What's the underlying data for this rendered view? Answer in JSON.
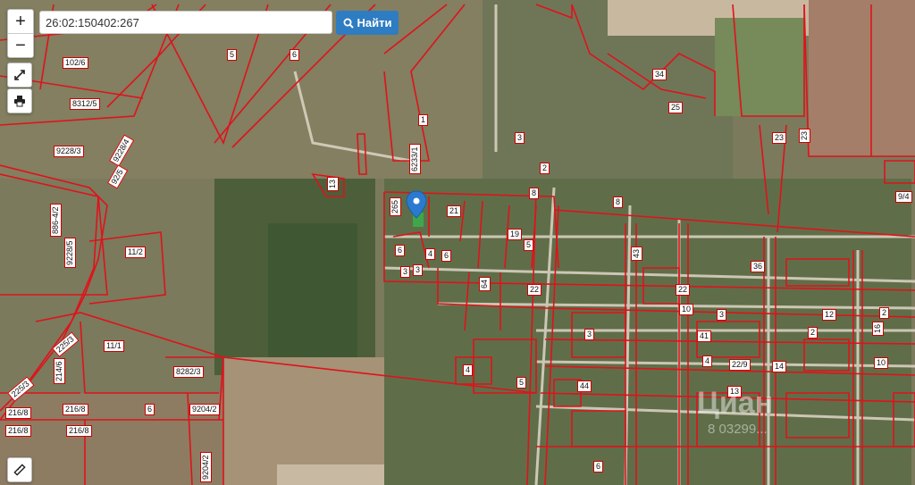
{
  "search": {
    "value": "26:02:150402:267",
    "button_label": "Найти"
  },
  "controls": {
    "zoom_in": "+",
    "zoom_out": "−"
  },
  "icons": {
    "search": "search-icon",
    "fullscreen": "expand-icon",
    "print": "printer-icon",
    "ruler": "ruler-icon",
    "marker": "map-marker-icon"
  },
  "colors": {
    "parcel_border": "#e0121b",
    "button": "#2e7cc2"
  },
  "watermark": {
    "brand": "Циан",
    "phone": "8 03299..."
  },
  "parcels": [
    {
      "id": "p1",
      "text": "102/6"
    },
    {
      "id": "p2",
      "text": "5"
    },
    {
      "id": "p3",
      "text": "6"
    },
    {
      "id": "p4",
      "text": "8312/5"
    },
    {
      "id": "p5",
      "text": "9228/3"
    },
    {
      "id": "p6",
      "text": "9228/4"
    },
    {
      "id": "p7",
      "text": "92/5"
    },
    {
      "id": "p8",
      "text": "11/2"
    },
    {
      "id": "p9",
      "text": "9228/5"
    },
    {
      "id": "p10",
      "text": "886-4/2"
    },
    {
      "id": "p11",
      "text": "225/3"
    },
    {
      "id": "p12",
      "text": "225/3"
    },
    {
      "id": "p13",
      "text": "214/6"
    },
    {
      "id": "p14",
      "text": "11/1"
    },
    {
      "id": "p15",
      "text": "8282/3"
    },
    {
      "id": "p16",
      "text": "216/8"
    },
    {
      "id": "p17",
      "text": "216/8"
    },
    {
      "id": "p18",
      "text": "216/8"
    },
    {
      "id": "p19",
      "text": "216/8"
    },
    {
      "id": "p20",
      "text": "6"
    },
    {
      "id": "p21",
      "text": "9204/2"
    },
    {
      "id": "p22",
      "text": "9204/2"
    },
    {
      "id": "p23",
      "text": "6233/1"
    },
    {
      "id": "p24",
      "text": "1"
    },
    {
      "id": "p25",
      "text": "3"
    },
    {
      "id": "p26",
      "text": "2"
    },
    {
      "id": "p27",
      "text": "34"
    },
    {
      "id": "p28",
      "text": "25"
    },
    {
      "id": "p29",
      "text": "23"
    },
    {
      "id": "p30",
      "text": "23"
    },
    {
      "id": "p31",
      "text": "265"
    },
    {
      "id": "p32",
      "text": "21"
    },
    {
      "id": "p33",
      "text": "13"
    },
    {
      "id": "p34",
      "text": "19"
    },
    {
      "id": "p35",
      "text": "5"
    },
    {
      "id": "p36",
      "text": "43"
    },
    {
      "id": "p37",
      "text": "36"
    },
    {
      "id": "p38",
      "text": "22"
    },
    {
      "id": "p39",
      "text": "64"
    },
    {
      "id": "p40",
      "text": "22"
    },
    {
      "id": "p41",
      "text": "10"
    },
    {
      "id": "p42",
      "text": "3"
    },
    {
      "id": "p43",
      "text": "41"
    },
    {
      "id": "p44",
      "text": "4"
    },
    {
      "id": "p45",
      "text": "22/9"
    },
    {
      "id": "p46",
      "text": "14"
    },
    {
      "id": "p47",
      "text": "4"
    },
    {
      "id": "p48",
      "text": "5"
    },
    {
      "id": "p49",
      "text": "44"
    },
    {
      "id": "p50",
      "text": "13"
    },
    {
      "id": "p51",
      "text": "12"
    },
    {
      "id": "p52",
      "text": "6"
    },
    {
      "id": "p53",
      "text": "10"
    },
    {
      "id": "p54",
      "text": "16"
    },
    {
      "id": "p55",
      "text": "9/4"
    },
    {
      "id": "p56",
      "text": "2"
    },
    {
      "id": "p57",
      "text": "6"
    },
    {
      "id": "p58",
      "text": "3"
    },
    {
      "id": "p59",
      "text": "3"
    },
    {
      "id": "p60",
      "text": "4"
    },
    {
      "id": "p61",
      "text": "8"
    },
    {
      "id": "p62",
      "text": "6"
    },
    {
      "id": "p63",
      "text": "3"
    },
    {
      "id": "p64",
      "text": "2"
    },
    {
      "id": "p65",
      "text": "8"
    }
  ]
}
